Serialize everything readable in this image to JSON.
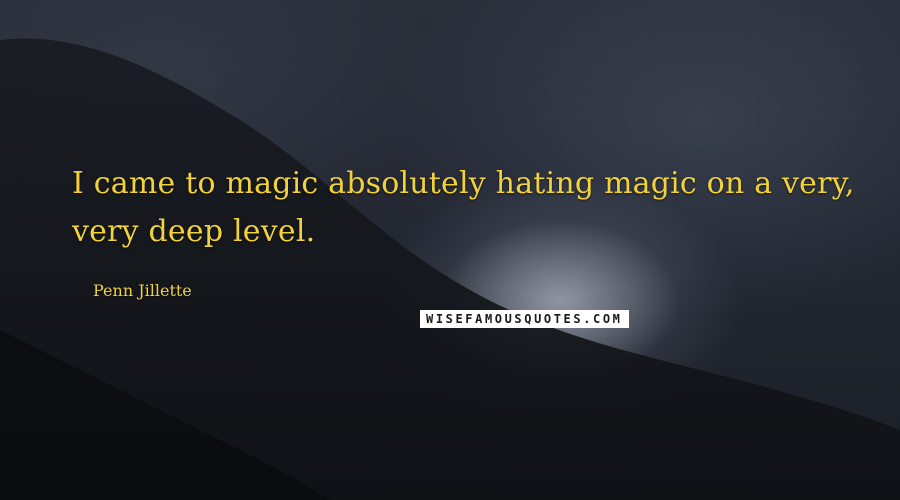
{
  "quote": {
    "text": "I came to magic absolutely hating magic on a very, very deep level.",
    "author": "Penn Jillette"
  },
  "watermark": {
    "text": "WISEFAMOUSQUOTES.COM"
  },
  "colors": {
    "quote_text": "#f2d23a",
    "background": "#1e222b",
    "watermark_bg": "#ffffff",
    "watermark_text": "#1a1a1a"
  }
}
